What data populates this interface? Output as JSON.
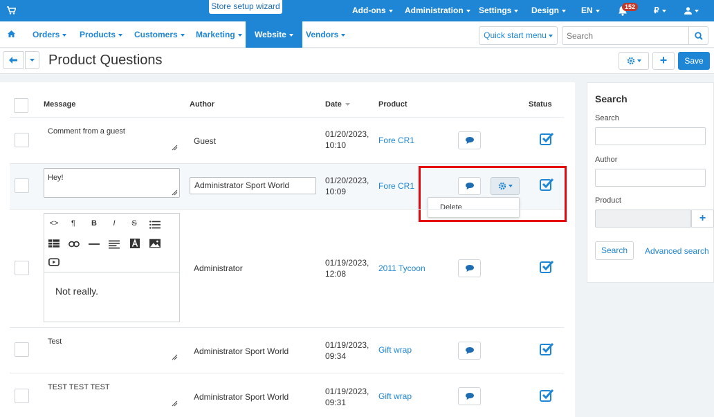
{
  "topbar": {
    "wizard_label": "Store setup wizard",
    "menus": [
      {
        "label": "Add-ons"
      },
      {
        "label": "Administration"
      },
      {
        "label": "Settings"
      },
      {
        "label": "Design"
      },
      {
        "label": "EN"
      },
      {
        "label": "₽"
      }
    ],
    "notifications_count": "152"
  },
  "nav": {
    "items": [
      {
        "label": "Orders"
      },
      {
        "label": "Products"
      },
      {
        "label": "Customers"
      },
      {
        "label": "Marketing"
      },
      {
        "label": "Website"
      },
      {
        "label": "Vendors"
      }
    ],
    "active": "Website",
    "quick_start_label": "Quick start menu",
    "search_placeholder": "Search"
  },
  "titlebar": {
    "title": "Product Questions",
    "save_label": "Save",
    "plus_label": "+"
  },
  "table": {
    "headers": {
      "message": "Message",
      "author": "Author",
      "date": "Date",
      "product": "Product",
      "status": "Status"
    },
    "rows": [
      {
        "message": "Comment from a guest",
        "author": "Guest",
        "date": "01/20/2023,",
        "time": "10:10",
        "product": "Fore CR1"
      },
      {
        "message": "Hey!",
        "author": "Administrator Sport World",
        "date": "01/20/2023,",
        "time": "10:09",
        "product": "Fore CR1"
      },
      {
        "message": "Not really.",
        "author": "Administrator",
        "date": "01/19/2023,",
        "time": "12:08",
        "product": "2011 Tycoon"
      },
      {
        "message": "Test",
        "author": "Administrator Sport World",
        "date": "01/19/2023,",
        "time": "09:34",
        "product": "Gift wrap"
      },
      {
        "message": "TEST TEST TEST",
        "author": "Administrator Sport World",
        "date": "01/19/2023,",
        "time": "09:31",
        "product": "Gift wrap"
      }
    ],
    "dropdown_delete": "Delete"
  },
  "editor_toolbar": {
    "code": "<>",
    "paragraph": "¶",
    "bold": "B",
    "italic": "I",
    "strike": "S"
  },
  "sidebar": {
    "title": "Search",
    "search_label": "Search",
    "author_label": "Author",
    "product_label": "Product",
    "plus_label": "+",
    "search_button": "Search",
    "advanced_link": "Advanced search"
  },
  "colors": {
    "accent": "#1e86d5",
    "highlight": "#e5060d"
  }
}
